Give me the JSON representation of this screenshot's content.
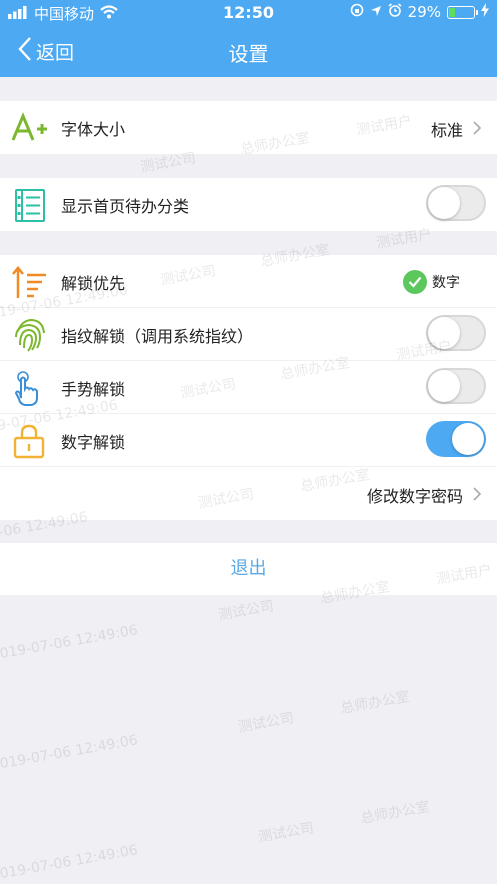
{
  "status": {
    "carrier": "中国移动",
    "time": "12:50",
    "battery_percent": "29%",
    "battery_level": 0.29,
    "icons": [
      "signal-icon",
      "wifi-icon",
      "orientation-lock-icon",
      "location-icon",
      "alarm-icon",
      "battery-icon",
      "charging-icon"
    ]
  },
  "nav": {
    "back_label": "返回",
    "title": "设置"
  },
  "settings": {
    "font_size": {
      "label": "字体大小",
      "value": "标准",
      "icon": "font-size-icon"
    },
    "show_todo": {
      "label": "显示首页待办分类",
      "on": false,
      "icon": "list-icon"
    },
    "unlock_priority": {
      "label": "解锁优先",
      "value": "数字",
      "icon": "priority-sort-icon"
    },
    "fingerprint_unlock": {
      "label": "指纹解锁（调用系统指纹）",
      "on": false,
      "icon": "fingerprint-icon"
    },
    "gesture_unlock": {
      "label": "手势解锁",
      "on": false,
      "icon": "hand-gesture-icon"
    },
    "number_unlock": {
      "label": "数字解锁",
      "on": true,
      "icon": "lock-icon"
    },
    "change_pin": {
      "label": "修改数字密码"
    }
  },
  "logout_label": "退出",
  "watermarks": {
    "company": "测试公司",
    "office": "总师办公室",
    "user": "测试用户",
    "date": "2019-07-06 12:49:06"
  },
  "colors": {
    "header": "#4da9f1",
    "accent_green": "#5cc75c",
    "toggle_on": "#4da9f1",
    "logout_text": "#5aa9e6",
    "icon_green": "#7cb82f",
    "icon_teal": "#2bbfa5",
    "icon_orange": "#f08a24",
    "icon_blue": "#3a8fd8",
    "icon_yellow": "#f2b233"
  }
}
